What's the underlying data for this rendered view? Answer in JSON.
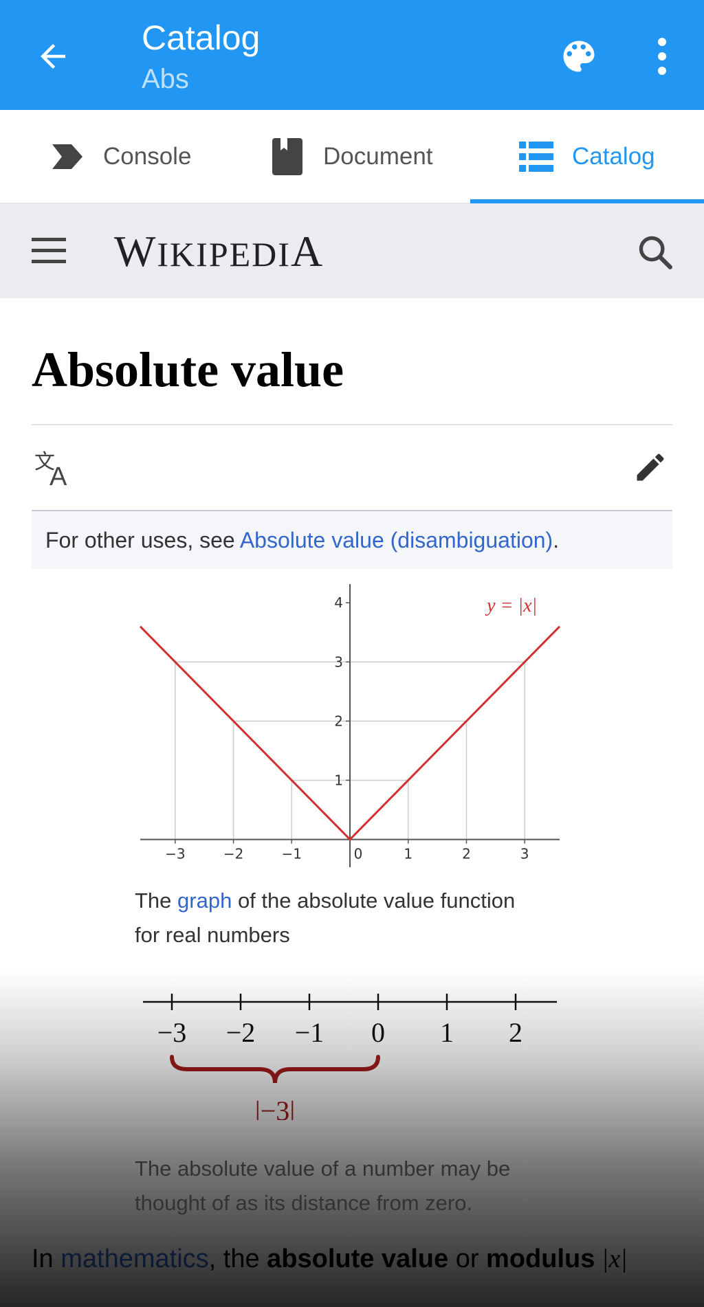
{
  "appbar": {
    "title": "Catalog",
    "subtitle": "Abs",
    "color": "#2196f3"
  },
  "tabs": [
    {
      "label": "Console",
      "icon": "console-chevron-icon",
      "active": false
    },
    {
      "label": "Document",
      "icon": "bookmark-book-icon",
      "active": false
    },
    {
      "label": "Catalog",
      "icon": "list-icon",
      "active": true
    }
  ],
  "wiki": {
    "logo": "Wikipedia",
    "article_title": "Absolute value",
    "hatnote_prefix": "For other uses, see ",
    "hatnote_link": "Absolute value (disambiguation)",
    "hatnote_suffix": "."
  },
  "figure1": {
    "caption_pre": "The ",
    "caption_link": "graph",
    "caption_post": " of the absolute value function",
    "caption_line2": "for real numbers"
  },
  "figure2": {
    "caption_line1": "The absolute value of a number may be",
    "caption_line2": "thought of as its distance from zero."
  },
  "paragraph": {
    "pre": "In ",
    "link": "mathematics",
    "mid": ", the ",
    "bold1": "absolute value",
    "or": " or ",
    "bold2": "modulus",
    "formula": " |x|"
  },
  "chart_data": [
    {
      "type": "line",
      "series": [
        {
          "name": "y = |x|",
          "x": [
            -3.6,
            0,
            3.6
          ],
          "y": [
            3.6,
            0,
            3.6
          ]
        }
      ],
      "legend_label": "y = |x|",
      "x_ticks": [
        "−3",
        "−2",
        "−1",
        "0",
        "1",
        "2",
        "3"
      ],
      "y_ticks": [
        "1",
        "2",
        "3",
        "4"
      ],
      "xlim": [
        -3.6,
        3.6
      ],
      "ylim": [
        -0.4,
        4.2
      ],
      "grid": "drop lines at integer points",
      "line_color": "#d32f2f"
    },
    {
      "type": "number-line",
      "ticks": [
        "−3",
        "−2",
        "−1",
        "0",
        "1",
        "2"
      ],
      "brace_from": -3,
      "brace_to": 0,
      "brace_label": "|−3|",
      "brace_color": "#a51d1d"
    }
  ]
}
